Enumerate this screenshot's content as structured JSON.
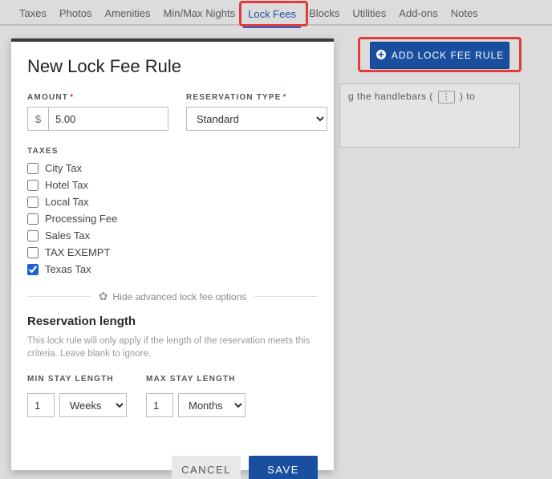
{
  "tabs": {
    "items": [
      "Taxes",
      "Photos",
      "Amenities",
      "Min/Max Nights",
      "Lock Fees",
      "Blocks",
      "Utilities",
      "Add-ons",
      "Notes"
    ],
    "active_index": 4
  },
  "add_rule_button": {
    "label": "ADD LOCK FEE RULE",
    "icon": "plus-circle-icon"
  },
  "bg_hint": {
    "prefix": "g the handlebars (",
    "glyph": "⋮",
    "suffix": ") to"
  },
  "modal": {
    "title": "New Lock Fee Rule",
    "amount": {
      "label": "AMOUNT",
      "required": true,
      "currency": "$",
      "value": "5.00"
    },
    "reservation_type": {
      "label": "RESERVATION TYPE",
      "required": true,
      "value": "Standard"
    },
    "taxes_label": "TAXES",
    "taxes": [
      {
        "label": "City Tax",
        "checked": false
      },
      {
        "label": "Hotel Tax",
        "checked": false
      },
      {
        "label": "Local Tax",
        "checked": false
      },
      {
        "label": "Processing Fee",
        "checked": false
      },
      {
        "label": "Sales Tax",
        "checked": false
      },
      {
        "label": "TAX EXEMPT",
        "checked": false
      },
      {
        "label": "Texas Tax",
        "checked": true
      }
    ],
    "divider_label": "Hide advanced lock fee options",
    "reservation_length": {
      "title": "Reservation length",
      "description": "This lock rule will only apply if the length of the reservation meets this criteria. Leave blank to ignore.",
      "min": {
        "label": "MIN STAY LENGTH",
        "value": "1",
        "unit": "Weeks"
      },
      "max": {
        "label": "MAX STAY LENGTH",
        "value": "1",
        "unit": "Months"
      }
    },
    "buttons": {
      "cancel": "CANCEL",
      "save": "SAVE"
    }
  }
}
